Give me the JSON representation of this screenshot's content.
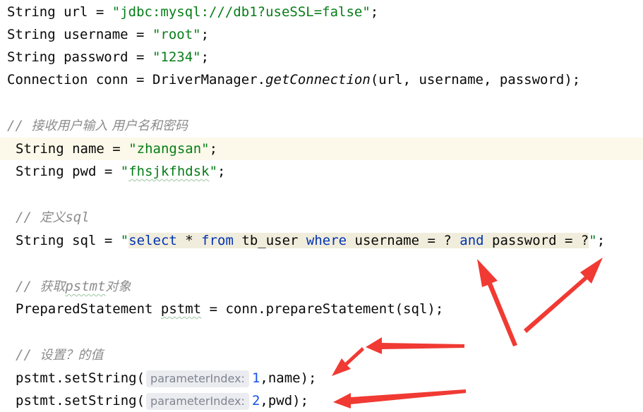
{
  "code": {
    "url_decl": {
      "type": "String",
      "name": "url",
      "op": " = ",
      "value": "\"jdbc:mysql:///db1?useSSL=false\"",
      "end": ";"
    },
    "username_decl": {
      "type": "String",
      "name": "username",
      "op": " = ",
      "value": "\"root\"",
      "end": ";"
    },
    "password_decl": {
      "type": "String",
      "name": "password",
      "op": " = ",
      "value": "\"1234\"",
      "end": ";"
    },
    "conn_decl": {
      "type": "Connection",
      "name": "conn",
      "op": " = ",
      "call_obj": "DriverManager.",
      "call_method": "getConnection",
      "args": "(url, username, password);"
    },
    "comment_input": {
      "prefix": "// ",
      "text": "接收用户输入 用户名和密码"
    },
    "name_decl": {
      "type": "String",
      "name": "name",
      "op": " = ",
      "value": "\"zhangsan\"",
      "end": ";"
    },
    "pwd_decl": {
      "type": "String",
      "name": "pwd",
      "op": " = ",
      "q1": "\"",
      "value": "fhsjkfhdsk",
      "q2": "\"",
      "end": ";"
    },
    "comment_sql": {
      "prefix": "// ",
      "text": "定义",
      "suffix": "sql"
    },
    "sql_decl": {
      "type": "String",
      "name": "sql",
      "op": " = ",
      "open_quote": "\"",
      "parts": [
        "select",
        " * ",
        "from",
        " tb_user ",
        "where",
        " username = ? ",
        "and",
        " password = ?"
      ],
      "close_quote": "\"",
      "end": ";"
    },
    "comment_pstmt": {
      "prefix": "// ",
      "text1": "获取",
      "word": "pstmt",
      "text2": "对象"
    },
    "pstmt_decl": {
      "type": "PreparedStatement",
      "name": "pstmt",
      "op": " = ",
      "call": "conn.prepareStatement(sql);"
    },
    "comment_set": {
      "prefix": "// ",
      "text": "设置？的值"
    },
    "set1": {
      "call": "pstmt.setString(",
      "hint": "parameterIndex:",
      "index": "1",
      "rest": ",name);"
    },
    "set2": {
      "call": "pstmt.setString(",
      "hint": "parameterIndex:",
      "index": "2",
      "rest": ",pwd);"
    }
  },
  "colors": {
    "string": "#067d17",
    "keyword": "#0033b3",
    "comment": "#8c8c8c",
    "number": "#1750eb",
    "highlight_line": "#fcf9ea",
    "sql_background": "#f1eddc",
    "arrow": "#f03a33"
  }
}
